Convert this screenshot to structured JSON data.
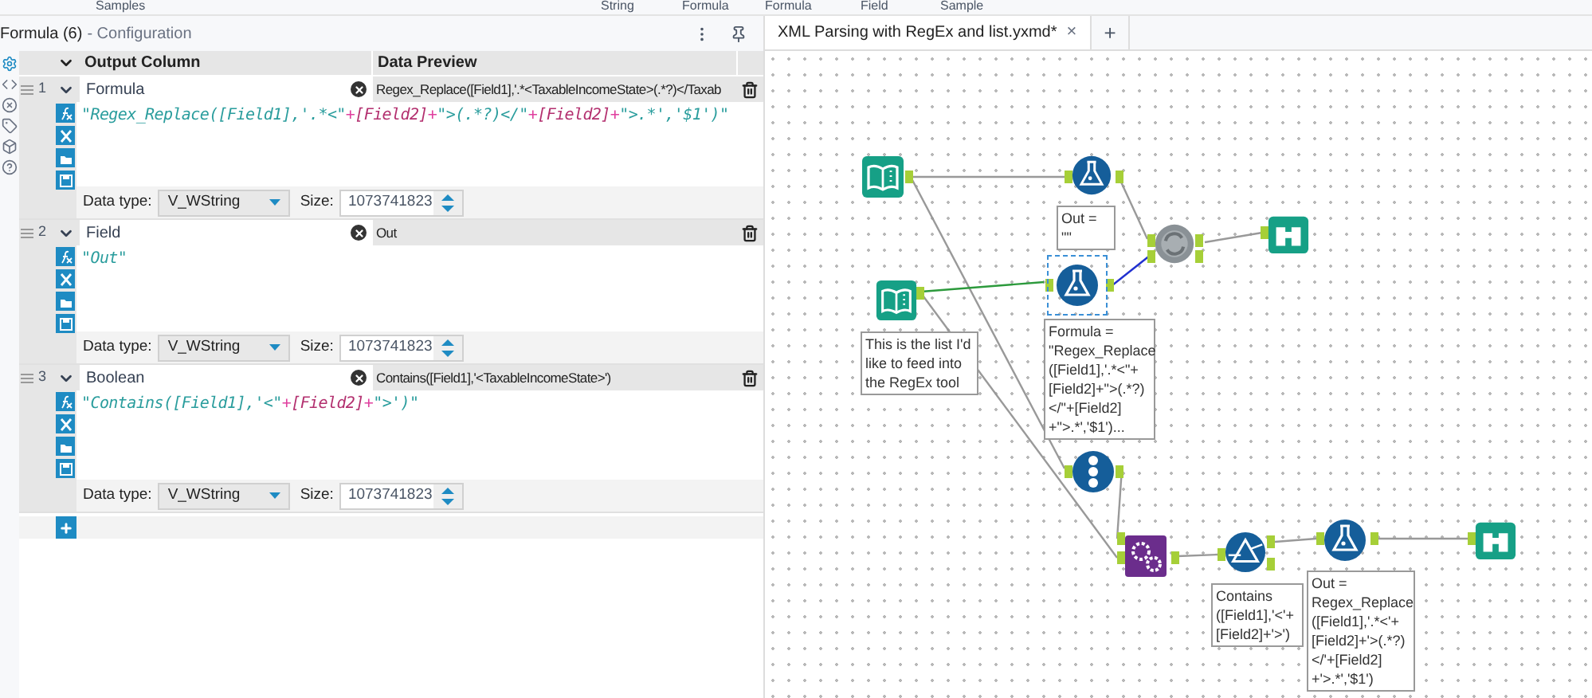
{
  "top_strip": [
    "Samples",
    "String",
    "Formula",
    "Formula",
    "Field",
    "Sample"
  ],
  "config": {
    "title": "Formula (6)",
    "subtitle": "- Configuration",
    "columns": [
      "Output Column",
      "Data Preview"
    ],
    "rows": [
      {
        "number": "1",
        "output": "Formula",
        "preview": "Regex_Replace([Field1],'.*<TaxableIncomeState>(.*?)</Taxab",
        "expression": [
          {
            "kind": "string",
            "text": "\"Regex_Replace([Field1],'.*<\""
          },
          {
            "kind": "op",
            "text": "+"
          },
          {
            "kind": "field",
            "text": "[Field2]"
          },
          {
            "kind": "op",
            "text": "+"
          },
          {
            "kind": "string",
            "text": "\">(.*?)</\""
          },
          {
            "kind": "op",
            "text": "+"
          },
          {
            "kind": "field",
            "text": "[Field2]"
          },
          {
            "kind": "op",
            "text": "+"
          },
          {
            "kind": "string",
            "text": "\">.*','$1')\""
          }
        ],
        "type_label": "Data type:",
        "type": "V_WString",
        "size_label": "Size:",
        "size": "1073741823"
      },
      {
        "number": "2",
        "output": "Field",
        "preview": "Out",
        "expression": [
          {
            "kind": "string",
            "text": "\"Out\""
          }
        ],
        "type_label": "Data type:",
        "type": "V_WString",
        "size_label": "Size:",
        "size": "1073741823"
      },
      {
        "number": "3",
        "output": "Boolean",
        "preview": "Contains([Field1],'<TaxableIncomeState>')",
        "expression": [
          {
            "kind": "string",
            "text": "\"Contains([Field1],'<\""
          },
          {
            "kind": "op",
            "text": "+"
          },
          {
            "kind": "field",
            "text": "[Field2]"
          },
          {
            "kind": "op",
            "text": "+"
          },
          {
            "kind": "string",
            "text": "\">')\""
          }
        ],
        "type_label": "Data type:",
        "type": "V_WString",
        "size_label": "Size:",
        "size": "1073741823"
      }
    ]
  },
  "tabs": [
    {
      "label": "XML Parsing with RegEx and list.yxmd*",
      "close": "×",
      "selected": true
    },
    {
      "label": "+",
      "selected": false
    }
  ],
  "canvas": {
    "nodes": [
      {
        "kind": "input",
        "selected": false
      },
      {
        "kind": "formula",
        "selected": false,
        "annotation": "Out = \"\""
      },
      {
        "kind": "append",
        "selected": false
      },
      {
        "kind": "browse",
        "selected": false
      },
      {
        "kind": "input",
        "selected": false,
        "annotation": "This is the list I'd like to feed into the RegEx tool"
      },
      {
        "kind": "formula",
        "selected": true,
        "annotation": "Formula = \"Regex_Replace ([Field1],'.*<\"+ [Field2]+\">(.*?) </\"+[Field2] +\">.*','$1')..."
      },
      {
        "kind": "recordid",
        "selected": false
      },
      {
        "kind": "dynamic",
        "selected": false
      },
      {
        "kind": "filter",
        "selected": false,
        "annotation": "Contains ([Field1],'<'+ [Field2]+'>')"
      },
      {
        "kind": "formula",
        "selected": false,
        "annotation": "Out = Regex_Replace ([Field1],'.*<'+ [Field2]+'>(.*?) </'+[Field2] +'>.*','$1')"
      },
      {
        "kind": "browse",
        "selected": false
      }
    ]
  }
}
